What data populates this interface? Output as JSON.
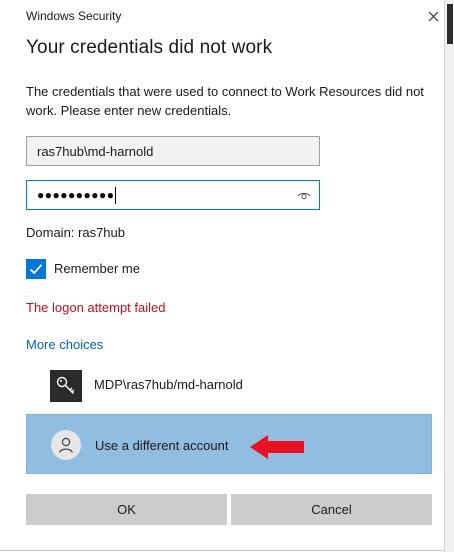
{
  "window": {
    "title": "Windows Security",
    "close_glyph": "✕"
  },
  "heading": "Your credentials did not work",
  "description": "The credentials that were used to connect to Work Resources did not work. Please enter new credentials.",
  "username": {
    "value": "ras7hub\\md-harnold"
  },
  "password": {
    "masked_value": "●●●●●●●●●●",
    "reveal_icon": "eye-icon"
  },
  "domain_text": "Domain: ras7hub",
  "remember": {
    "label": "Remember me",
    "checked": true
  },
  "error_text": "The logon attempt failed",
  "more_choices": "More choices",
  "accounts": [
    {
      "label": "MDP\\ras7hub/md-harnold",
      "icon": "key-icon"
    },
    {
      "label": "Use a different account",
      "icon": "person-icon",
      "selected": true
    }
  ],
  "buttons": {
    "ok": "OK",
    "cancel": "Cancel"
  },
  "colors": {
    "accent": "#0078d7",
    "error": "#c50f1f",
    "selected_row": "#91bde0",
    "annotation_arrow": "#e81123"
  }
}
